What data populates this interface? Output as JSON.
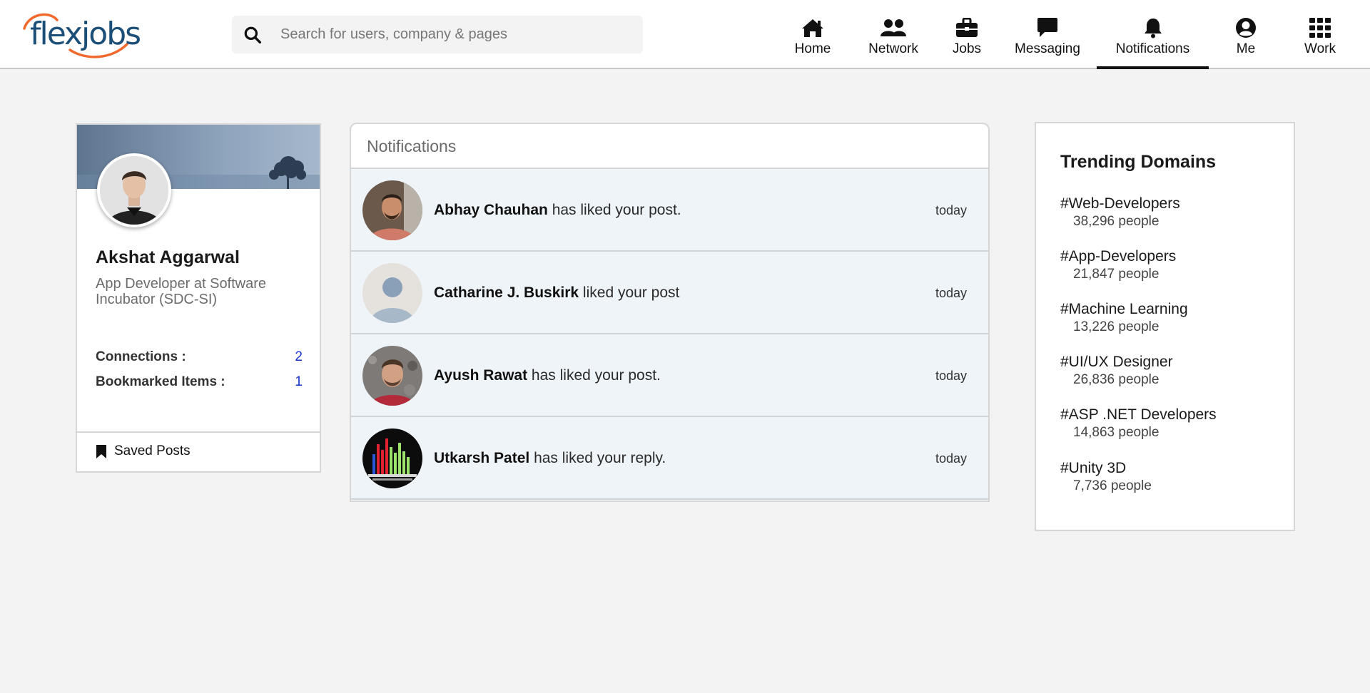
{
  "header": {
    "logo_text": "flexjobs",
    "search": {
      "placeholder": "Search for users, company & pages",
      "value": ""
    },
    "nav": [
      {
        "id": "home",
        "label": "Home",
        "icon": "home-icon",
        "active": false
      },
      {
        "id": "network",
        "label": "Network",
        "icon": "people-icon",
        "active": false
      },
      {
        "id": "jobs",
        "label": "Jobs",
        "icon": "briefcase-icon",
        "active": false
      },
      {
        "id": "messaging",
        "label": "Messaging",
        "icon": "message-icon",
        "active": false
      },
      {
        "id": "notifications",
        "label": "Notifications",
        "icon": "bell-icon",
        "active": true
      },
      {
        "id": "me",
        "label": "Me",
        "icon": "user-circle-icon",
        "active": false
      },
      {
        "id": "work",
        "label": "Work",
        "icon": "grid-icon",
        "active": false
      }
    ]
  },
  "profile": {
    "name": "Akshat Aggarwal",
    "headline": "App Developer at Software Incubator (SDC-SI)",
    "connections_label": "Connections :",
    "connections_value": "2",
    "bookmarks_label": "Bookmarked Items :",
    "bookmarks_value": "1",
    "saved_posts_label": "Saved Posts"
  },
  "notifications": {
    "title": "Notifications",
    "items": [
      {
        "name": "Abhay Chauhan",
        "text": " has liked your post.",
        "time": "today"
      },
      {
        "name": "Catharine J. Buskirk",
        "text": " liked your post",
        "time": "today"
      },
      {
        "name": "Ayush Rawat",
        "text": " has liked your post.",
        "time": "today"
      },
      {
        "name": "Utkarsh Patel",
        "text": " has liked your reply.",
        "time": "today"
      }
    ]
  },
  "trending": {
    "title": "Trending Domains",
    "items": [
      {
        "tag": "#Web-Developers",
        "count": "38,296 people"
      },
      {
        "tag": "#App-Developers",
        "count": "21,847 people"
      },
      {
        "tag": "#Machine Learning",
        "count": "13,226 people"
      },
      {
        "tag": "#UI/UX Designer",
        "count": "26,836 people"
      },
      {
        "tag": "#ASP .NET Developers",
        "count": "14,863 people"
      },
      {
        "tag": "#Unity 3D",
        "count": "7,736 people"
      }
    ]
  },
  "colors": {
    "accent_link": "#1a33d1",
    "logo_blue": "#1b4f78",
    "logo_orange": "#f06a2e",
    "row_bg": "#eff4f9"
  }
}
